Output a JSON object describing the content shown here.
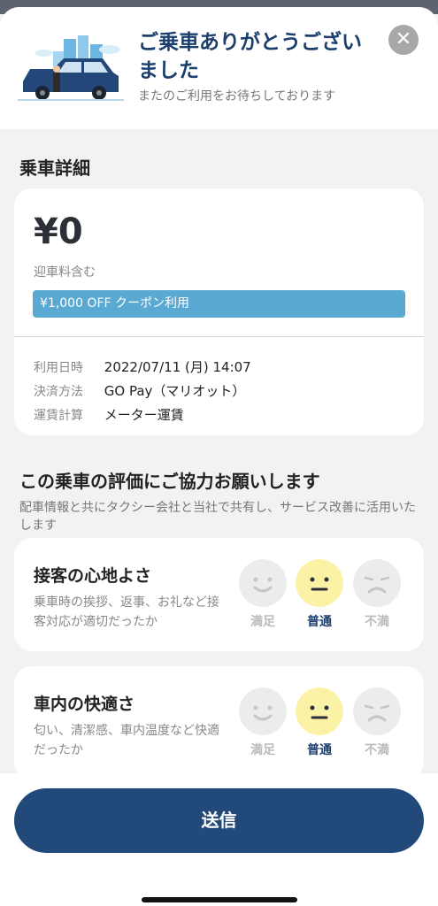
{
  "header": {
    "title": "ご乗車ありがとうございました",
    "subtitle": "またのご利用をお待ちしております"
  },
  "ride_details": {
    "section_title": "乗車詳細",
    "fare": "¥0",
    "fare_note": "迎車料含む",
    "coupon": "¥1,000 OFF クーポン利用",
    "rows": [
      {
        "label": "利用日時",
        "value": "2022/07/11 (月) 14:07"
      },
      {
        "label": "決済方法",
        "value": "GO Pay（マリオット）"
      },
      {
        "label": "運賃計算",
        "value": "メーター運賃"
      }
    ]
  },
  "rating": {
    "title": "この乗車の評価にご協力お願いします",
    "description": "配車情報と共にタクシー会社と当社で共有し、サービス改善に活用いたします",
    "options": [
      "満足",
      "普通",
      "不満"
    ],
    "cards": [
      {
        "title": "接客の心地よさ",
        "description": "乗車時の挨拶、返事、お礼など接客対応が適切だったか",
        "selected": "普通"
      },
      {
        "title": "車内の快適さ",
        "description": "匂い、清潔感、車内温度など快適だったか",
        "selected": "普通"
      }
    ]
  },
  "footer": {
    "send_label": "送信"
  },
  "icons": {
    "close": "close-icon",
    "car": "taxi-illustration"
  },
  "colors": {
    "primary": "#21497a",
    "title": "#1d3f6e",
    "coupon": "#5aa9d2",
    "face_selected": "#fbf2a6",
    "face_default": "#ececec"
  }
}
